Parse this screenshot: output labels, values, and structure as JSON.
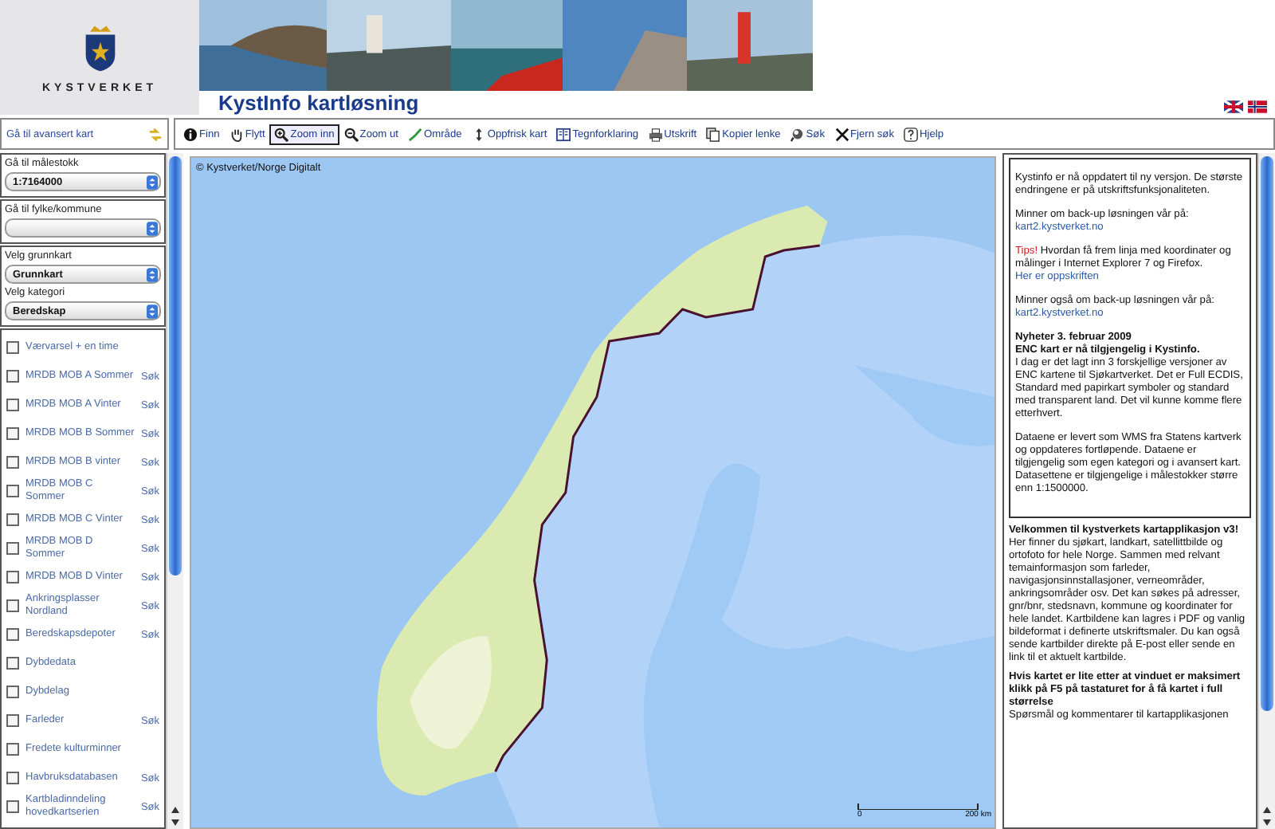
{
  "header": {
    "logo_text": "KYSTVERKET",
    "title": "KystInfo kartløsning"
  },
  "advanced_link": "Gå til avansert kart",
  "toolbar": [
    {
      "label": "Finn",
      "kind": "info",
      "selected": false
    },
    {
      "label": "Flytt",
      "kind": "hand",
      "selected": false
    },
    {
      "label": "Zoom inn",
      "kind": "zoomin",
      "selected": true
    },
    {
      "label": "Zoom ut",
      "kind": "zoomout",
      "selected": false
    },
    {
      "label": "Område",
      "kind": "area",
      "selected": false
    },
    {
      "label": "Oppfrisk kart",
      "kind": "refresh",
      "selected": false
    },
    {
      "label": "Tegnforklaring",
      "kind": "legend",
      "selected": false
    },
    {
      "label": "Utskrift",
      "kind": "print",
      "selected": false
    },
    {
      "label": "Kopier lenke",
      "kind": "copy",
      "selected": false
    },
    {
      "label": "Søk",
      "kind": "search",
      "selected": false
    },
    {
      "label": "Fjern søk",
      "kind": "clear",
      "selected": false
    },
    {
      "label": "Hjelp",
      "kind": "help",
      "selected": false
    }
  ],
  "sidebar": {
    "groups": [
      {
        "fields": [
          {
            "label": "Gå til målestokk",
            "value": "1:7164000"
          }
        ]
      },
      {
        "fields": [
          {
            "label": "Gå til fylke/kommune"
          }
        ]
      },
      {
        "fields": [
          {
            "label": "Velg grunnkart",
            "value": "Grunnkart"
          },
          {
            "label": "Velg kategori",
            "value": "Beredskap"
          }
        ]
      }
    ],
    "layers": [
      {
        "label": "Værvarsel + en time",
        "checked": false
      },
      {
        "label": "MRDB MOB A Sommer",
        "checked": false,
        "search": "Søk"
      },
      {
        "label": "MRDB MOB A Vinter",
        "checked": false,
        "search": "Søk"
      },
      {
        "label": "MRDB MOB B Sommer",
        "checked": false,
        "search": "Søk"
      },
      {
        "label": "MRDB MOB B vinter",
        "checked": false,
        "search": "Søk"
      },
      {
        "label": "MRDB MOB C Sommer",
        "checked": false,
        "search": "Søk"
      },
      {
        "label": "MRDB MOB C Vinter",
        "checked": false,
        "search": "Søk"
      },
      {
        "label": "MRDB MOB D Sommer",
        "checked": false,
        "search": "Søk"
      },
      {
        "label": "MRDB MOB D Vinter",
        "checked": false,
        "search": "Søk"
      },
      {
        "label": "Ankringsplasser Nordland",
        "checked": false,
        "search": "Søk"
      },
      {
        "label": "Beredskapsdepoter",
        "checked": false,
        "search": "Søk"
      },
      {
        "label": "Dybdedata",
        "checked": false
      },
      {
        "label": "Dybdelag",
        "checked": false
      },
      {
        "label": "Farleder",
        "checked": false,
        "search": "Søk"
      },
      {
        "label": "Fredete kulturminner",
        "checked": false
      },
      {
        "label": "Havbruksdatabasen",
        "checked": false,
        "search": "Søk"
      },
      {
        "label": "Kartbladinndeling hovedkartserien",
        "checked": false,
        "search": "Søk"
      }
    ]
  },
  "map": {
    "kind": "picture",
    "copyright": "© Kystverket/Norge Digitalt",
    "scale_labels": [
      "0",
      "200 km"
    ]
  },
  "info_box": [
    {
      "parts": [
        {
          "kind": "text",
          "text": "Kystinfo er nå oppdatert til ny versjon. De største endringene er på utskriftsfunksjonaliteten."
        }
      ]
    },
    {
      "parts": [
        {
          "kind": "text",
          "text": "Minner om back-up løsningen vår på: "
        },
        {
          "kind": "link",
          "text": "kart2.kystverket.no"
        }
      ]
    },
    {
      "parts": [
        {
          "kind": "alert",
          "text": "Tips!"
        },
        {
          "kind": "text",
          "text": " Hvordan få frem linja med koordinater og målinger i Internet Explorer 7 og Firefox. "
        },
        {
          "kind": "link",
          "text": "Her er oppskriften"
        }
      ]
    },
    {
      "parts": [
        {
          "kind": "text",
          "text": "Minner også om back-up løsningen vår på: "
        },
        {
          "kind": "link",
          "text": "kart2.kystverket.no"
        }
      ]
    },
    {
      "heading": [
        "Nyheter 3. februar 2009",
        "ENC kart er nå tilgjengelig i Kystinfo."
      ],
      "parts": [
        {
          "kind": "text",
          "text": "I dag er det lagt inn 3 forskjellige versjoner av ENC kartene til Sjøkartverket. Det er Full ECDIS, Standard med papirkart symboler og standard med transparent land. Det vil kunne komme flere etterhvert."
        }
      ]
    },
    {
      "parts": [
        {
          "kind": "text",
          "text": "Dataene er levert som WMS fra Statens kartverk og oppdateres fortløpende. Dataene er tilgjengelig som egen kategori og i avansert kart. Datasettene er tilgjengelige i målestokker større enn 1:1500000."
        }
      ]
    }
  ],
  "after_box": [
    {
      "heading": [
        "Velkommen til kystverkets kartapplikasjon v3!"
      ],
      "parts": [
        {
          "kind": "text",
          "text": "Her finner du sjøkart, landkart, satellittbilde og ortofoto for hele Norge. Sammen med relvant temainformasjon som farleder, navigasjonsinnstallasjoner, verneområder, ankringsområder osv. Det kan søkes på adresser, gnr/bnr, stedsnavn, kommune og koordinater for hele landet. Kartbildene kan lagres i PDF og vanlig bildeformat i definerte utskriftsmaler. Du kan også sende kartbilder direkte på E-post eller sende en link til et aktuelt kartbilde."
        }
      ]
    },
    {
      "heading": [
        "Hvis kartet er lite etter at vinduet er maksimert klikk på F5 på tastaturet for å få kartet i full størrelse"
      ]
    },
    {
      "parts": [
        {
          "kind": "text",
          "text": "Spørsmål og kommentarer til kartapplikasjonen"
        }
      ]
    }
  ]
}
